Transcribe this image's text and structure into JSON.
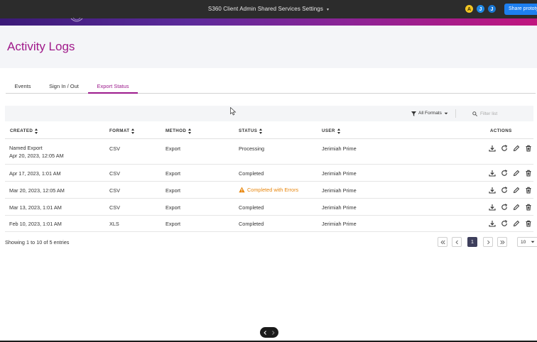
{
  "topbar": {
    "title": "S360 Client Admin Shared Services Settings",
    "avatars": [
      "A",
      "J",
      "J"
    ],
    "share_label": "Share prototype"
  },
  "header": {
    "title": "Activity Logs"
  },
  "tabs": [
    {
      "label": "Events",
      "active": false
    },
    {
      "label": "Sign In / Out",
      "active": false
    },
    {
      "label": "Export Status",
      "active": true
    }
  ],
  "toolbar": {
    "formats_label": "All Formats",
    "filter_placeholder": "Filter list"
  },
  "table": {
    "columns": [
      "CREATED",
      "FORMAT",
      "METHOD",
      "STATUS",
      "USER",
      "ACTIONS"
    ],
    "rows": [
      {
        "name": "Named Export",
        "created": "Apr 20, 2023, 12:05 AM",
        "format": "CSV",
        "method": "Export",
        "status": "Processing",
        "user": "Jerimiah Prime"
      },
      {
        "created": "Apr 17, 2023, 1:01 AM",
        "format": "CSV",
        "method": "Export",
        "status": "Completed",
        "user": "Jerimiah Prime"
      },
      {
        "created": "Mar 20, 2023, 12:05 AM",
        "format": "CSV",
        "method": "Export",
        "status": "Completed with Errors",
        "user": "Jerimiah Prime"
      },
      {
        "created": "Mar 13, 2023, 1:01 AM",
        "format": "CSV",
        "method": "Export",
        "status": "Completed",
        "user": "Jerimiah Prime"
      },
      {
        "created": "Feb 10, 2023, 1:01 AM",
        "format": "XLS",
        "method": "Export",
        "status": "Completed",
        "user": "Jerimiah Prime"
      }
    ]
  },
  "footer": {
    "entries_text": "Showing 1 to 10 of 5 entries",
    "current_page": "1",
    "page_size": "10"
  },
  "colors": {
    "accent": "#9c1a8c",
    "warning": "#e8860d",
    "pager_active": "#3e3f5c"
  }
}
